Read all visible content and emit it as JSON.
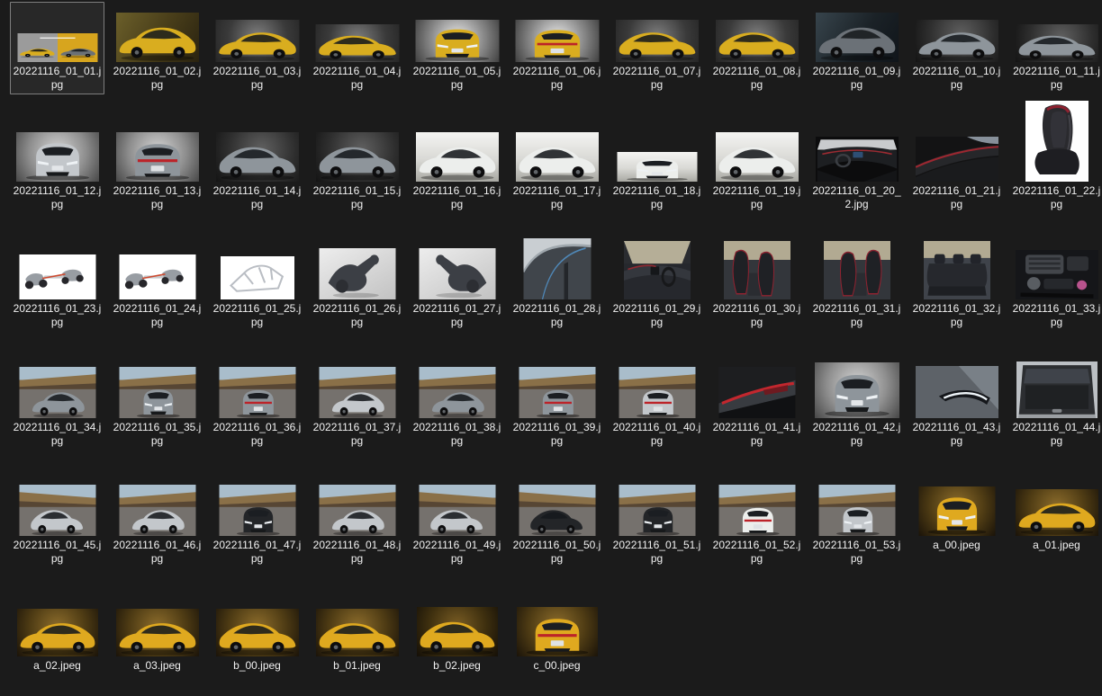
{
  "window": {
    "background_color": "#1b1b1b",
    "selection_border_color": "#7e7e7e",
    "selection_fill_color": "rgba(255,255,255,0.06)",
    "label_color": "#f1f1f1"
  },
  "thumb_palette": {
    "backgrounds": {
      "grayRadial": "radial-gradient(circle at 50% 40%, #7f7f7f 0%, #3a3a3a 60%, #262626 100%)",
      "grayBright": "radial-gradient(circle at 50% 45%, #ececec 0%, #8a8a8a 55%, #3f3f3f 100%)",
      "lightRadial": "radial-gradient(circle at 50% 40%, #d6d6d6 0%, #8f8f8f 55%, #474747 100%)",
      "darkRadial": "radial-gradient(circle at 55% 35%, #606060 0%, #2e2e2e 60%, #141414 100%)",
      "wallYellow": "linear-gradient(120deg, #6b5f2a 0%, #4a3f1a 50%, #2a2310 100%)",
      "darkConcrete": "linear-gradient(120deg, #37444c 0%, #1b2227 55%, #10151a 100%)",
      "whiteStudio": "linear-gradient(180deg, #f4f4f2 0%, #d9d9d5 55%, #a8a8a2 100%)",
      "white": "#ffffff",
      "suspLight": "linear-gradient(150deg, #ededed 0%, #c2c2c2 100%)",
      "gold": "radial-gradient(circle at 50% 38%, #8d6d2c 0%, #4f3c14 55%, #1a1309 100%)",
      "goldDark": "radial-gradient(circle at 50% 38%, #7a5d24 0%, #3f300f 55%, #140f07 100%)",
      "interiorDark": "#101011"
    },
    "cars": {
      "yellow": "#d9ad1f",
      "gray": "#8e959b",
      "silver": "#c3c7cb",
      "white": "#eceeec",
      "black": "#232528",
      "gold": "#dfa91f",
      "darkgray": "#6b7177"
    }
  },
  "files": [
    {
      "name": "20221116_01_01.jpg",
      "selected": true,
      "thumb": {
        "kind": "banner",
        "w": 89,
        "h": 32
      }
    },
    {
      "name": "20221116_01_02.jpg",
      "thumb": {
        "kind": "side",
        "bg": "wallYellow",
        "car": "yellow",
        "w": 92,
        "h": 55
      }
    },
    {
      "name": "20221116_01_03.jpg",
      "thumb": {
        "kind": "side",
        "bg": "grayRadial",
        "car": "yellow",
        "w": 93,
        "h": 47
      }
    },
    {
      "name": "20221116_01_04.jpg",
      "thumb": {
        "kind": "side",
        "bg": "grayRadial",
        "car": "yellow",
        "flip": true,
        "w": 93,
        "h": 42
      }
    },
    {
      "name": "20221116_01_05.jpg",
      "thumb": {
        "kind": "front",
        "bg": "grayBright",
        "car": "yellow",
        "w": 93,
        "h": 47
      }
    },
    {
      "name": "20221116_01_06.jpg",
      "thumb": {
        "kind": "rear",
        "bg": "grayBright",
        "car": "yellow",
        "w": 93,
        "h": 47
      }
    },
    {
      "name": "20221116_01_07.jpg",
      "thumb": {
        "kind": "side",
        "bg": "grayRadial",
        "car": "yellow",
        "flip": true,
        "w": 92,
        "h": 47
      }
    },
    {
      "name": "20221116_01_08.jpg",
      "thumb": {
        "kind": "side",
        "bg": "grayRadial",
        "car": "yellow",
        "flip": true,
        "w": 92,
        "h": 47
      }
    },
    {
      "name": "20221116_01_09.jpg",
      "thumb": {
        "kind": "side",
        "bg": "darkConcrete",
        "car": "darkgray",
        "w": 92,
        "h": 55
      }
    },
    {
      "name": "20221116_01_10.jpg",
      "thumb": {
        "kind": "side",
        "bg": "darkRadial",
        "car": "gray",
        "w": 92,
        "h": 47
      }
    },
    {
      "name": "20221116_01_11.jpg",
      "thumb": {
        "kind": "side",
        "bg": "darkRadial",
        "car": "gray",
        "flip": true,
        "w": 92,
        "h": 42
      }
    },
    {
      "name": "20221116_01_12.jpg",
      "thumb": {
        "kind": "front",
        "bg": "lightRadial",
        "car": "silver",
        "w": 92,
        "h": 55
      }
    },
    {
      "name": "20221116_01_13.jpg",
      "thumb": {
        "kind": "rear",
        "bg": "lightRadial",
        "car": "gray",
        "w": 92,
        "h": 55
      }
    },
    {
      "name": "20221116_01_14.jpg",
      "thumb": {
        "kind": "side",
        "bg": "darkRadial",
        "car": "gray",
        "flip": true,
        "w": 92,
        "h": 55
      }
    },
    {
      "name": "20221116_01_15.jpg",
      "thumb": {
        "kind": "side",
        "bg": "darkRadial",
        "car": "gray",
        "flip": true,
        "w": 92,
        "h": 55
      }
    },
    {
      "name": "20221116_01_16.jpg",
      "thumb": {
        "kind": "side",
        "bg": "whiteStudio",
        "car": "white",
        "w": 92,
        "h": 55
      }
    },
    {
      "name": "20221116_01_17.jpg",
      "thumb": {
        "kind": "side",
        "bg": "whiteStudio",
        "car": "white",
        "flip": true,
        "w": 92,
        "h": 55
      }
    },
    {
      "name": "20221116_01_18.jpg",
      "thumb": {
        "kind": "front",
        "bg": "whiteStudio",
        "car": "white",
        "w": 89,
        "h": 33
      }
    },
    {
      "name": "20221116_01_19.jpg",
      "thumb": {
        "kind": "side",
        "bg": "whiteStudio",
        "car": "white",
        "flip": true,
        "w": 92,
        "h": 55
      }
    },
    {
      "name": "20221116_01_20_2.jpg",
      "thumb": {
        "kind": "dash",
        "bg": "interiorDark",
        "w": 92,
        "h": 50
      }
    },
    {
      "name": "20221116_01_21.jpg",
      "thumb": {
        "kind": "trim",
        "bg": "interiorDark",
        "w": 92,
        "h": 50
      }
    },
    {
      "name": "20221116_01_22.jpg",
      "thumb": {
        "kind": "seat",
        "bg": "white",
        "w": 70,
        "h": 90
      }
    },
    {
      "name": "20221116_01_23.jpg",
      "thumb": {
        "kind": "chassis",
        "bg": "white",
        "w": 85,
        "h": 50
      }
    },
    {
      "name": "20221116_01_24.jpg",
      "thumb": {
        "kind": "chassis",
        "bg": "white",
        "w": 85,
        "h": 50
      }
    },
    {
      "name": "20221116_01_25.jpg",
      "thumb": {
        "kind": "frame",
        "bg": "white",
        "w": 82,
        "h": 48
      }
    },
    {
      "name": "20221116_01_26.jpg",
      "thumb": {
        "kind": "susp",
        "bg": "suspLight",
        "w": 85,
        "h": 57
      }
    },
    {
      "name": "20221116_01_27.jpg",
      "thumb": {
        "kind": "susp",
        "bg": "suspLight",
        "flip": true,
        "w": 85,
        "h": 57
      }
    },
    {
      "name": "20221116_01_28.jpg",
      "thumb": {
        "kind": "window",
        "w": 75,
        "h": 68
      }
    },
    {
      "name": "20221116_01_29.jpg",
      "thumb": {
        "kind": "dashPhoto",
        "w": 74,
        "h": 65
      }
    },
    {
      "name": "20221116_01_30.jpg",
      "thumb": {
        "kind": "seatsF",
        "w": 74,
        "h": 65
      }
    },
    {
      "name": "20221116_01_31.jpg",
      "thumb": {
        "kind": "seatsF",
        "flip": true,
        "w": 74,
        "h": 65
      }
    },
    {
      "name": "20221116_01_32.jpg",
      "thumb": {
        "kind": "seatsR",
        "w": 74,
        "h": 65
      }
    },
    {
      "name": "20221116_01_33.jpg",
      "thumb": {
        "kind": "engine",
        "w": 92,
        "h": 55
      }
    },
    {
      "name": "20221116_01_34.jpg",
      "thumb": {
        "kind": "track",
        "view": "side",
        "car": "gray",
        "w": 85,
        "h": 57
      }
    },
    {
      "name": "20221116_01_35.jpg",
      "thumb": {
        "kind": "track",
        "view": "front",
        "car": "gray",
        "w": 85,
        "h": 57
      }
    },
    {
      "name": "20221116_01_36.jpg",
      "thumb": {
        "kind": "track",
        "view": "rear",
        "car": "gray",
        "w": 85,
        "h": 57
      }
    },
    {
      "name": "20221116_01_37.jpg",
      "thumb": {
        "kind": "track",
        "view": "side",
        "car": "silver",
        "w": 85,
        "h": 57
      }
    },
    {
      "name": "20221116_01_38.jpg",
      "thumb": {
        "kind": "track",
        "view": "side",
        "car": "gray",
        "w": 85,
        "h": 57
      }
    },
    {
      "name": "20221116_01_39.jpg",
      "thumb": {
        "kind": "track",
        "view": "rear",
        "car": "gray",
        "w": 85,
        "h": 57
      }
    },
    {
      "name": "20221116_01_40.jpg",
      "thumb": {
        "kind": "track",
        "view": "rear",
        "car": "silver",
        "w": 85,
        "h": 57
      }
    },
    {
      "name": "20221116_01_41.jpg",
      "thumb": {
        "kind": "taillight",
        "w": 85,
        "h": 57
      }
    },
    {
      "name": "20221116_01_42.jpg",
      "thumb": {
        "kind": "front",
        "bg": "lightRadial",
        "car": "gray",
        "w": 94,
        "h": 62
      }
    },
    {
      "name": "20221116_01_43.jpg",
      "thumb": {
        "kind": "headlight",
        "w": 92,
        "h": 58
      }
    },
    {
      "name": "20221116_01_44.jpg",
      "thumb": {
        "kind": "trunk",
        "w": 90,
        "h": 63
      }
    },
    {
      "name": "20221116_01_45.jpg",
      "thumb": {
        "kind": "track",
        "view": "side",
        "car": "silver",
        "flip": true,
        "w": 85,
        "h": 57
      }
    },
    {
      "name": "20221116_01_46.jpg",
      "thumb": {
        "kind": "track",
        "view": "side",
        "car": "silver",
        "w": 85,
        "h": 57
      }
    },
    {
      "name": "20221116_01_47.jpg",
      "thumb": {
        "kind": "track",
        "view": "front",
        "car": "black",
        "w": 85,
        "h": 57
      }
    },
    {
      "name": "20221116_01_48.jpg",
      "thumb": {
        "kind": "track",
        "view": "side",
        "car": "silver",
        "w": 85,
        "h": 57
      }
    },
    {
      "name": "20221116_01_49.jpg",
      "thumb": {
        "kind": "track",
        "view": "side",
        "car": "silver",
        "flip": true,
        "w": 85,
        "h": 57
      }
    },
    {
      "name": "20221116_01_50.jpg",
      "thumb": {
        "kind": "track",
        "view": "side",
        "car": "black",
        "flip": true,
        "w": 85,
        "h": 57
      }
    },
    {
      "name": "20221116_01_51.jpg",
      "thumb": {
        "kind": "track",
        "view": "front",
        "car": "black",
        "w": 85,
        "h": 57
      }
    },
    {
      "name": "20221116_01_52.jpg",
      "thumb": {
        "kind": "track",
        "view": "rear",
        "car": "white",
        "w": 85,
        "h": 57
      }
    },
    {
      "name": "20221116_01_53.jpg",
      "thumb": {
        "kind": "track",
        "view": "front",
        "car": "silver",
        "w": 85,
        "h": 57
      }
    },
    {
      "name": "a_00.jpeg",
      "thumb": {
        "kind": "front",
        "bg": "gold",
        "car": "gold",
        "w": 85,
        "h": 55
      }
    },
    {
      "name": "a_01.jpeg",
      "thumb": {
        "kind": "side",
        "bg": "gold",
        "car": "gold",
        "w": 92,
        "h": 52
      }
    },
    {
      "name": "a_02.jpeg",
      "thumb": {
        "kind": "side",
        "bg": "gold",
        "car": "gold",
        "w": 90,
        "h": 53
      }
    },
    {
      "name": "a_03.jpeg",
      "thumb": {
        "kind": "side",
        "bg": "gold",
        "car": "gold",
        "w": 92,
        "h": 53
      }
    },
    {
      "name": "b_00.jpeg",
      "thumb": {
        "kind": "side",
        "bg": "gold",
        "car": "gold",
        "flip": true,
        "w": 92,
        "h": 53
      }
    },
    {
      "name": "b_01.jpeg",
      "thumb": {
        "kind": "side",
        "bg": "gold",
        "car": "gold",
        "flip": true,
        "w": 92,
        "h": 53
      }
    },
    {
      "name": "b_02.jpeg",
      "thumb": {
        "kind": "side",
        "bg": "goldDark",
        "car": "gold",
        "flip": true,
        "w": 90,
        "h": 55
      }
    },
    {
      "name": "c_00.jpeg",
      "thumb": {
        "kind": "rear",
        "bg": "gold",
        "car": "gold",
        "w": 90,
        "h": 55
      }
    }
  ]
}
